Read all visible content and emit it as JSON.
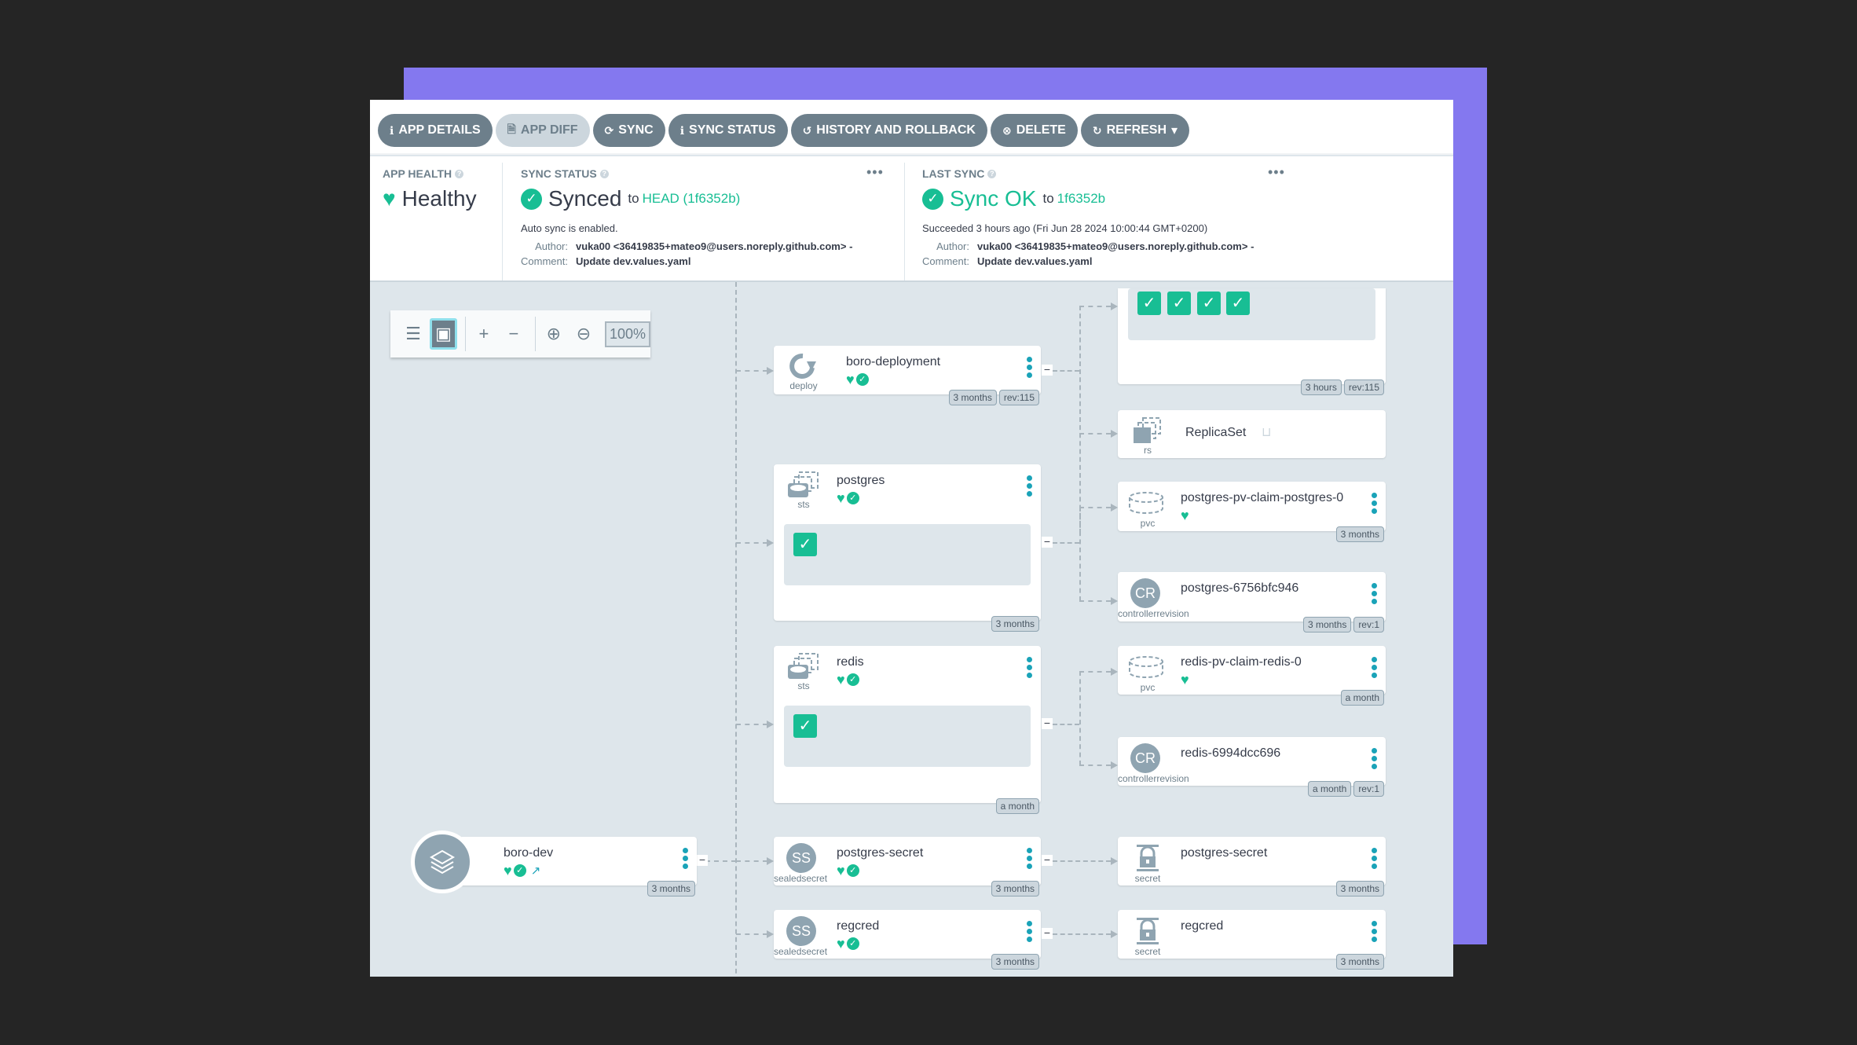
{
  "toolbar": {
    "buttons": [
      {
        "label": "APP DETAILS",
        "icon": "info-circle-icon",
        "glyph": "ℹ"
      },
      {
        "label": "APP DIFF",
        "icon": "file-diff-icon",
        "glyph": "🗎",
        "disabled": true
      },
      {
        "label": "SYNC",
        "icon": "sync-icon",
        "glyph": "⟳"
      },
      {
        "label": "SYNC STATUS",
        "icon": "info-circle-icon",
        "glyph": "ℹ"
      },
      {
        "label": "HISTORY AND ROLLBACK",
        "icon": "history-icon",
        "glyph": "↺"
      },
      {
        "label": "DELETE",
        "icon": "times-circle-icon",
        "glyph": "⊗"
      },
      {
        "label": "REFRESH",
        "icon": "redo-icon",
        "glyph": "↻",
        "dropdown": "▾"
      }
    ]
  },
  "app_health": {
    "title": "APP HEALTH",
    "value": "Healthy",
    "icon": "heart-icon"
  },
  "sync_status": {
    "title": "SYNC STATUS",
    "value": "Synced",
    "to_label": "to",
    "revision": "HEAD (1f6352b)",
    "auto_sync": "Auto sync is enabled.",
    "author_label": "Author:",
    "author": "vuka00 <36419835+mateo9@users.noreply.github.com> -",
    "comment_label": "Comment:",
    "comment": "Update dev.values.yaml",
    "more": "•••"
  },
  "last_sync": {
    "title": "LAST SYNC",
    "value": "Sync OK",
    "to_label": "to",
    "revision": "1f6352b",
    "succeeded": "Succeeded 3 hours ago (Fri Jun 28 2024 10:00:44 GMT+0200)",
    "author_label": "Author:",
    "author": "vuka00 <36419835+mateo9@users.noreply.github.com> -",
    "comment_label": "Comment:",
    "comment": "Update dev.values.yaml",
    "more": "•••"
  },
  "graph_tools": {
    "zoom": "100%"
  },
  "colors": {
    "healthy": "#18be94",
    "button": "#6d7f8b",
    "accent_frame": "#8478ef",
    "menu_dots": "#1aa3b8"
  },
  "nodes": {
    "app": {
      "name": "boro-dev",
      "age": "3 months"
    },
    "deployment": {
      "name": "boro-deployment",
      "kind": "deploy",
      "age": "3 months",
      "rev": "rev:115"
    },
    "rs_group": {
      "age": "3 hours",
      "rev": "rev:115",
      "pods": 4
    },
    "replicaset": {
      "name": "ReplicaSet",
      "kind": "rs"
    },
    "postgres": {
      "name": "postgres",
      "kind": "sts",
      "age": "3 months",
      "pods": 1
    },
    "postgres_pvc": {
      "name": "postgres-pv-claim-postgres-0",
      "kind": "pvc",
      "age": "3 months"
    },
    "postgres_cr": {
      "name": "postgres-6756bfc946",
      "kind": "controllerrevision",
      "initials": "CR",
      "age": "3 months",
      "rev": "rev:1"
    },
    "redis": {
      "name": "redis",
      "kind": "sts",
      "age": "a month",
      "pods": 1
    },
    "redis_pvc": {
      "name": "redis-pv-claim-redis-0",
      "kind": "pvc",
      "age": "a month"
    },
    "redis_cr": {
      "name": "redis-6994dcc696",
      "kind": "controllerrevision",
      "initials": "CR",
      "age": "a month",
      "rev": "rev:1"
    },
    "pg_sealed": {
      "name": "postgres-secret",
      "kind": "sealedsecret",
      "initials": "SS",
      "age": "3 months"
    },
    "pg_secret": {
      "name": "postgres-secret",
      "kind": "secret",
      "age": "3 months"
    },
    "reg_sealed": {
      "name": "regcred",
      "kind": "sealedsecret",
      "initials": "SS",
      "age": "3 months"
    },
    "reg_secret": {
      "name": "regcred",
      "kind": "secret",
      "age": "3 months"
    }
  }
}
